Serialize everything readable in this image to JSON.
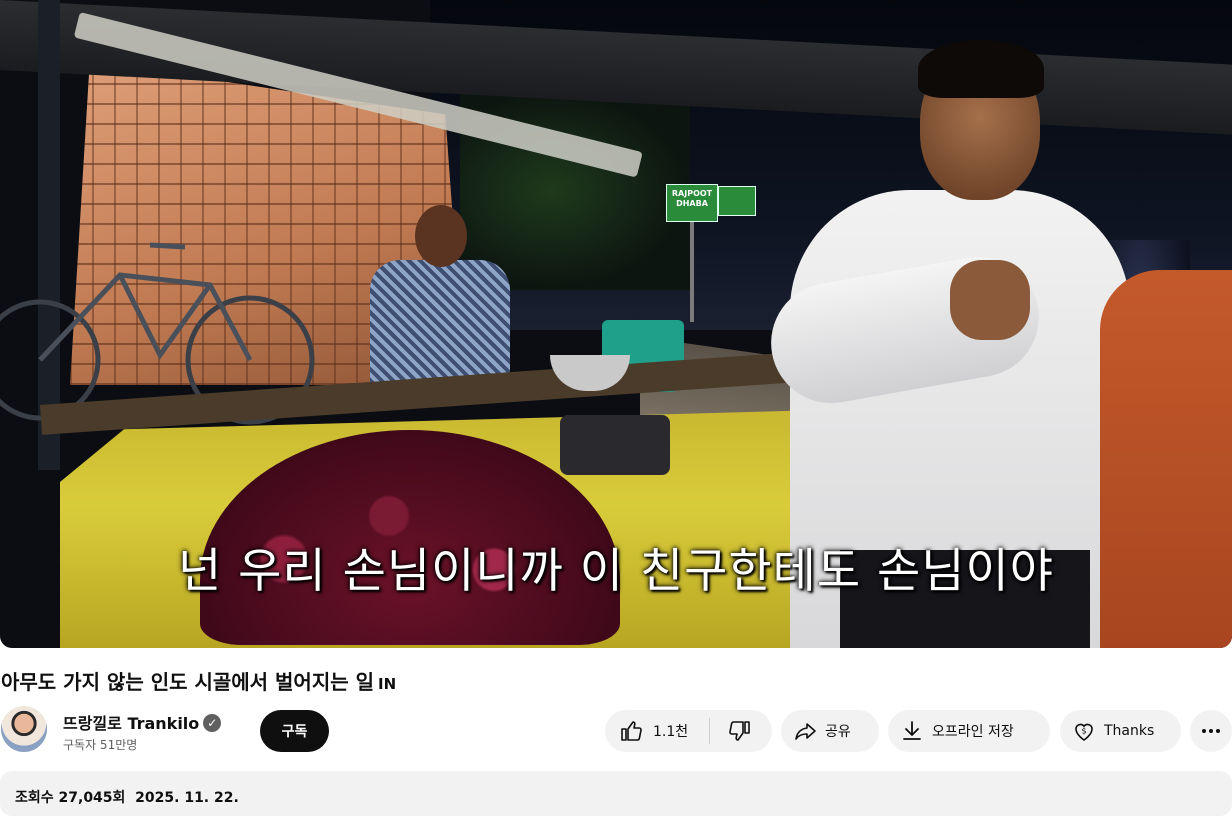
{
  "player": {
    "subtitle": "넌 우리 손님이니까 이 친구한테도 손님이야",
    "sign_text": "RAJPOOT DHABA"
  },
  "video": {
    "title": "아무도 가지 않는 인도 시골에서 벌어지는 일",
    "title_tag": "IN"
  },
  "channel": {
    "name": "뜨랑낄로 Trankilo",
    "verified_mark": "✓",
    "subscribers": "구독자 51만명",
    "subscribe_label": "구독"
  },
  "actions": {
    "like_count": "1.1천",
    "share_label": "공유",
    "save_label": "오프라인 저장",
    "thanks_label": "Thanks",
    "icons": [
      "like-icon",
      "dislike-icon",
      "share-icon",
      "download-icon",
      "thanks-icon",
      "more-icon"
    ]
  },
  "description": {
    "views": "조회수 27,045회",
    "date": "2025. 11. 22."
  }
}
